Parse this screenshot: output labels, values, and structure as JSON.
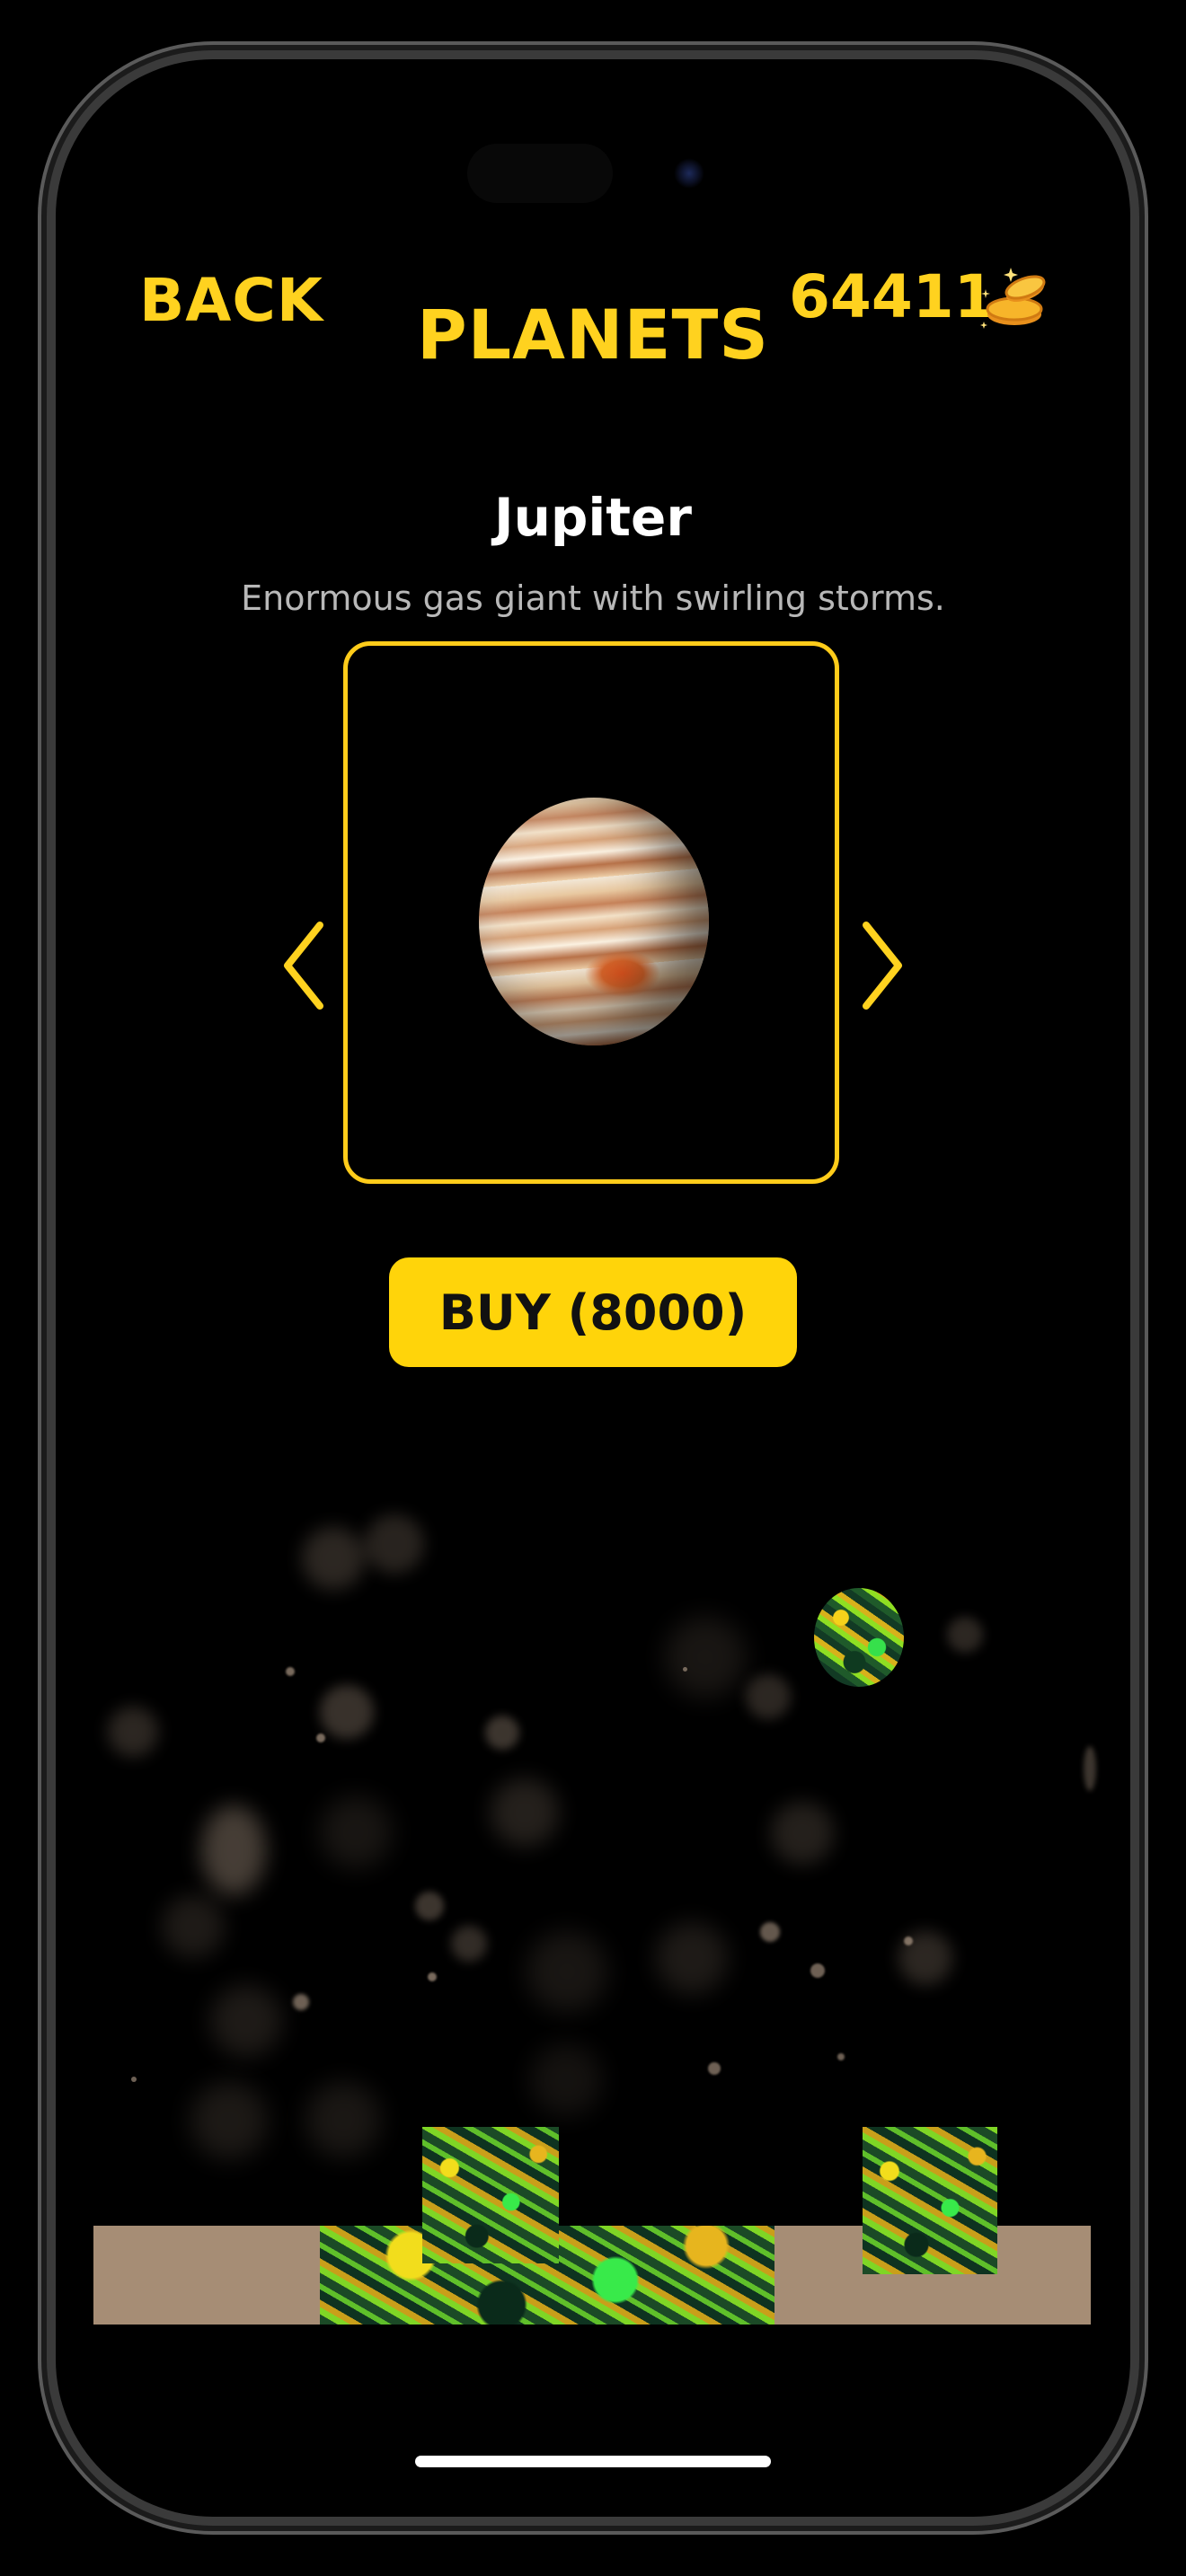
{
  "header": {
    "back_label": "BACK",
    "title": "PLANETS",
    "coin_balance": "64411",
    "coin_icon": "gold-coins-icon"
  },
  "planet": {
    "name": "Jupiter",
    "description": "Enormous gas giant with swirling storms.",
    "image": "jupiter-planet-image"
  },
  "carousel": {
    "prev_icon": "chevron-left-icon",
    "next_icon": "chevron-right-icon"
  },
  "buy_button": {
    "label": "BUY (8000)"
  },
  "colors": {
    "accent": "#ffd21f",
    "button": "#ffd40a",
    "background": "#000000",
    "ground": "#a68d75",
    "description_text": "#b8b8b8"
  }
}
